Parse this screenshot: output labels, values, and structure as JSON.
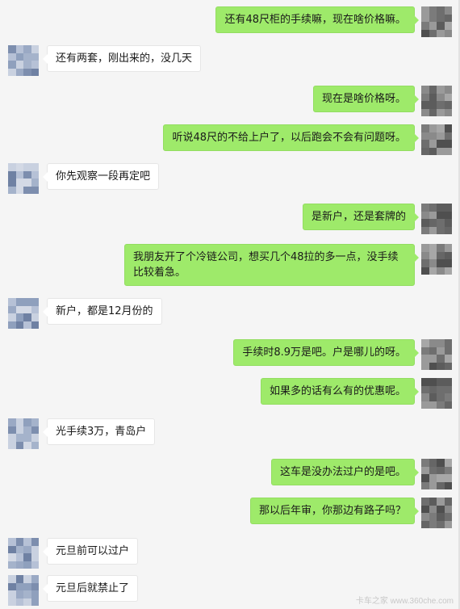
{
  "chat": {
    "messages": [
      {
        "side": "right",
        "text": "还有48尺柜的手续嘛，现在啥价格嘛。"
      },
      {
        "side": "left",
        "text": "还有两套，刚出来的，没几天"
      },
      {
        "side": "right",
        "text": "现在是啥价格呀。"
      },
      {
        "side": "right",
        "text": "听说48尺的不给上户了，以后跑会不会有问题呀。"
      },
      {
        "side": "left",
        "text": "你先观察一段再定吧"
      },
      {
        "side": "right",
        "text": "是新户，还是套牌的"
      },
      {
        "side": "right",
        "text": "我朋友开了个冷链公司，想买几个48拉的多一点，没手续比较着急。"
      },
      {
        "side": "left",
        "text": "新户，都是12月份的"
      },
      {
        "side": "right",
        "text": "手续时8.9万是吧。户是哪儿的呀。"
      },
      {
        "side": "right",
        "text": "如果多的话有么有的优惠呢。"
      },
      {
        "side": "left",
        "text": "光手续3万，青岛户"
      },
      {
        "side": "right",
        "text": "这车是没办法过户的是吧。"
      },
      {
        "side": "right",
        "text": "那以后年审，你那边有路子吗？"
      },
      {
        "side": "left",
        "text": "元旦前可以过户"
      },
      {
        "side": "left",
        "text": "元旦后就禁止了"
      }
    ]
  },
  "watermark": "卡车之家 www.360che.com",
  "colors": {
    "background": "#f5f5f5",
    "bubble_self": "#9eea6a",
    "bubble_other": "#ffffff"
  }
}
